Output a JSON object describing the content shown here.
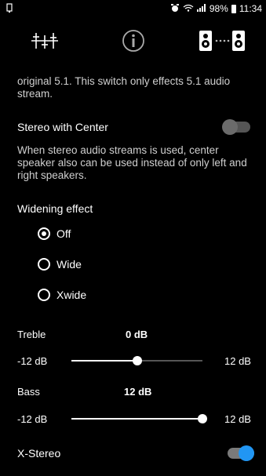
{
  "status": {
    "battery": "98%",
    "time": "11:34"
  },
  "toolbar": {
    "tabs": [
      {
        "icon": "equalizer-sliders-icon"
      },
      {
        "icon": "info-icon"
      },
      {
        "icon": "speakers-icon"
      }
    ]
  },
  "settings": {
    "top_desc": "original 5.1. This switch only effects 5.1 audio stream.",
    "stereo_center": {
      "label": "Stereo with Center",
      "enabled": false,
      "desc": "When stereo audio streams is used, center speaker also can be used instead of only left and right speakers."
    },
    "widening": {
      "label": "Widening effect",
      "options": [
        "Off",
        "Wide",
        "Xwide"
      ],
      "selected": "Off"
    },
    "treble": {
      "label": "Treble",
      "value": "0 dB",
      "min": "-12 dB",
      "max": "12 dB",
      "fraction": 0.5
    },
    "bass": {
      "label": "Bass",
      "value": "12 dB",
      "min": "-12 dB",
      "max": "12 dB",
      "fraction": 1.0
    },
    "xstereo": {
      "label": "X-Stereo",
      "enabled": true
    }
  },
  "colors": {
    "accent": "#2196F3",
    "toggle_off_track": "#555555",
    "toggle_off_thumb": "#6b6b6b",
    "toggle_on_track": "#7a7a7a"
  }
}
